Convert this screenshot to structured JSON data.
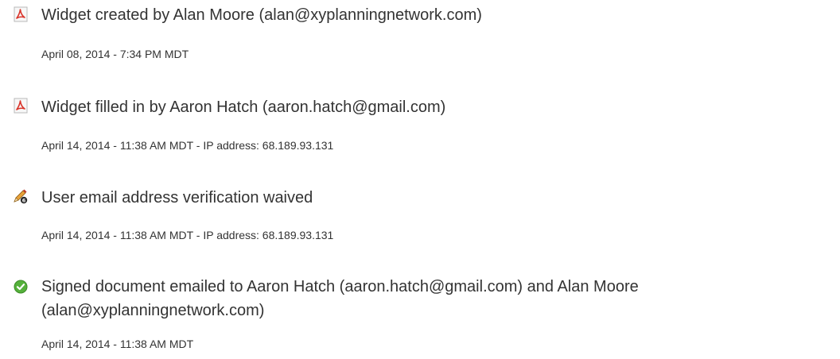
{
  "events": [
    {
      "icon": "pdf-icon",
      "title": "Widget created by Alan Moore (alan@xyplanningnetwork.com)",
      "meta": "April 08, 2014 - 7:34 PM MDT"
    },
    {
      "icon": "pdf-icon",
      "title": "Widget filled in by Aaron Hatch (aaron.hatch@gmail.com)",
      "meta": "April 14, 2014 - 11:38 AM MDT - IP address: 68.189.93.131"
    },
    {
      "icon": "pencil-waived-icon",
      "title": "User email address verification waived",
      "meta": "April 14, 2014 - 11:38 AM MDT - IP address: 68.189.93.131"
    },
    {
      "icon": "green-check-icon",
      "title": "Signed document emailed to Aaron Hatch (aaron.hatch@gmail.com) and Alan Moore (alan@xyplanningnetwork.com)",
      "meta": "April 14, 2014 - 11:38 AM MDT"
    }
  ],
  "colors": {
    "text": "#333333",
    "pdf_red": "#d9352b",
    "check_green": "#55b13b"
  }
}
